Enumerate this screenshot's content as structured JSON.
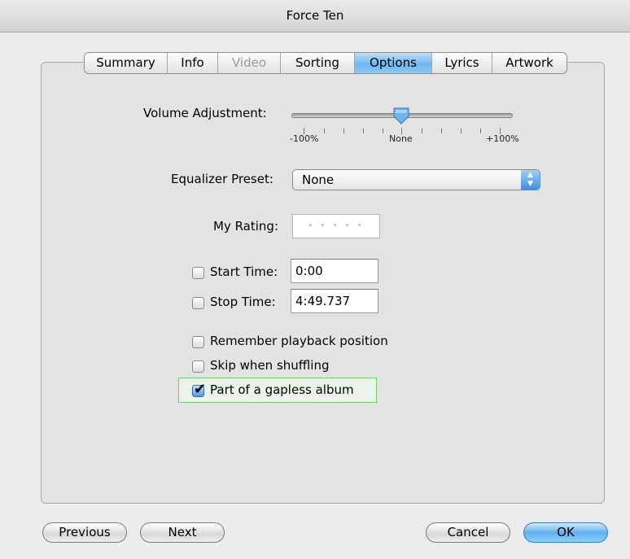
{
  "window": {
    "title": "Force Ten"
  },
  "tabs": [
    {
      "label": "Summary",
      "state": "normal"
    },
    {
      "label": "Info",
      "state": "normal"
    },
    {
      "label": "Video",
      "state": "disabled"
    },
    {
      "label": "Sorting",
      "state": "normal"
    },
    {
      "label": "Options",
      "state": "selected"
    },
    {
      "label": "Lyrics",
      "state": "normal"
    },
    {
      "label": "Artwork",
      "state": "normal"
    }
  ],
  "options": {
    "volume": {
      "label": "Volume Adjustment:",
      "min_label": "-100%",
      "mid_label": "None",
      "max_label": "+100%",
      "value_percent": 0
    },
    "equalizer": {
      "label": "Equalizer Preset:",
      "value": "None"
    },
    "rating": {
      "label": "My Rating:",
      "placeholder": "• • • • •",
      "stars": 0
    },
    "start_time": {
      "label": "Start Time:",
      "value": "0:00",
      "checked": false
    },
    "stop_time": {
      "label": "Stop Time:",
      "value": "4:49.737",
      "checked": false
    },
    "remember_playback": {
      "label": "Remember playback position",
      "checked": false
    },
    "skip_shuffling": {
      "label": "Skip when shuffling",
      "checked": false
    },
    "gapless": {
      "label": "Part of a gapless album",
      "checked": true
    }
  },
  "buttons": {
    "previous": "Previous",
    "next": "Next",
    "cancel": "Cancel",
    "ok": "OK"
  },
  "colors": {
    "selected_tab": "#6fb7f2",
    "default_button": "#5fb0f1",
    "highlight_border": "#78c978"
  }
}
